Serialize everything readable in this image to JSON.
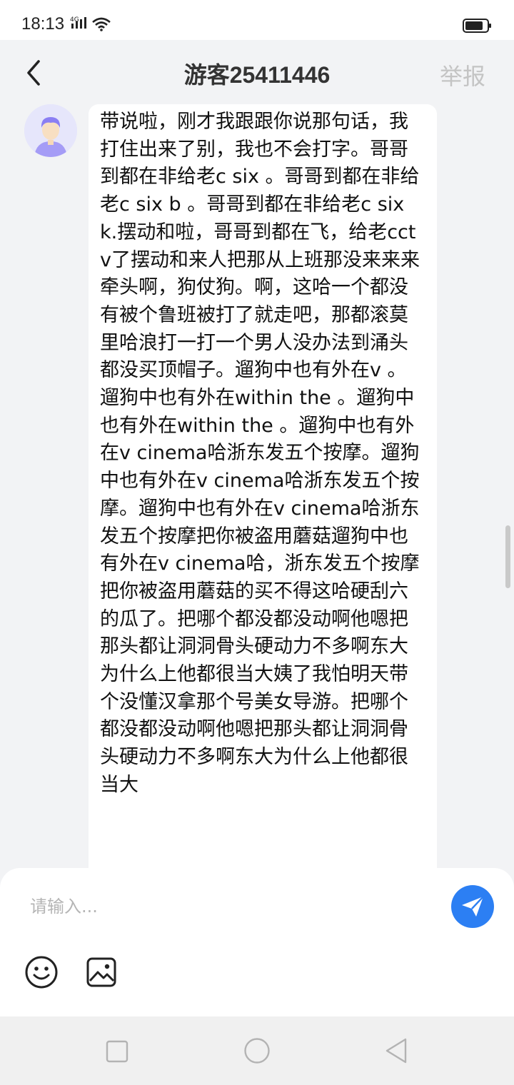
{
  "status_bar": {
    "time": "18:13",
    "network": "4G"
  },
  "header": {
    "title": "游客25411446",
    "report_label": "举报",
    "back_icon": "chevron-left-icon"
  },
  "chat": {
    "avatar_icon": "user-avatar-icon",
    "message": "带说啦，刚才我跟跟你说那句话，我打住出来了别，我也不会打字。哥哥到都在非给老c six 。哥哥到都在非给老c six b 。哥哥到都在非给老c six k.摆动和啦，哥哥到都在飞，给老cctv了摆动和来人把那从上班那没来来来牵头啊，狗仗狗。啊，这哈一个都没有被个鲁班被打了就走吧，那都滚莫里哈浪打一打一个男人没办法到涌头都没买顶帽子。遛狗中也有外在v 。遛狗中也有外在within the 。遛狗中也有外在within the 。遛狗中也有外在v cinema哈浙东发五个按摩。遛狗中也有外在v cinema哈浙东发五个按摩。遛狗中也有外在v cinema哈浙东发五个按摩把你被盗用蘑菇遛狗中也有外在v cinema哈，浙东发五个按摩把你被盗用蘑菇的买不得这哈硬刮六的瓜了。把哪个都没都没动啊他嗯把那头都让洞洞骨头硬动力不多啊东大为什么上他都很当大姨了我怕明天带个没懂汉拿那个号美女导游。把哪个都没都没动啊他嗯把那头都让洞洞骨头硬动力不多啊东大为什么上他都很当大"
  },
  "composer": {
    "placeholder": "请输入...",
    "send_icon": "paper-plane-icon",
    "emoji_icon": "emoji-icon",
    "image_icon": "image-icon",
    "accent_color": "#2c7ff3"
  },
  "nav_bar": {
    "icons": [
      "square-recents-icon",
      "circle-home-icon",
      "triangle-back-icon"
    ]
  }
}
